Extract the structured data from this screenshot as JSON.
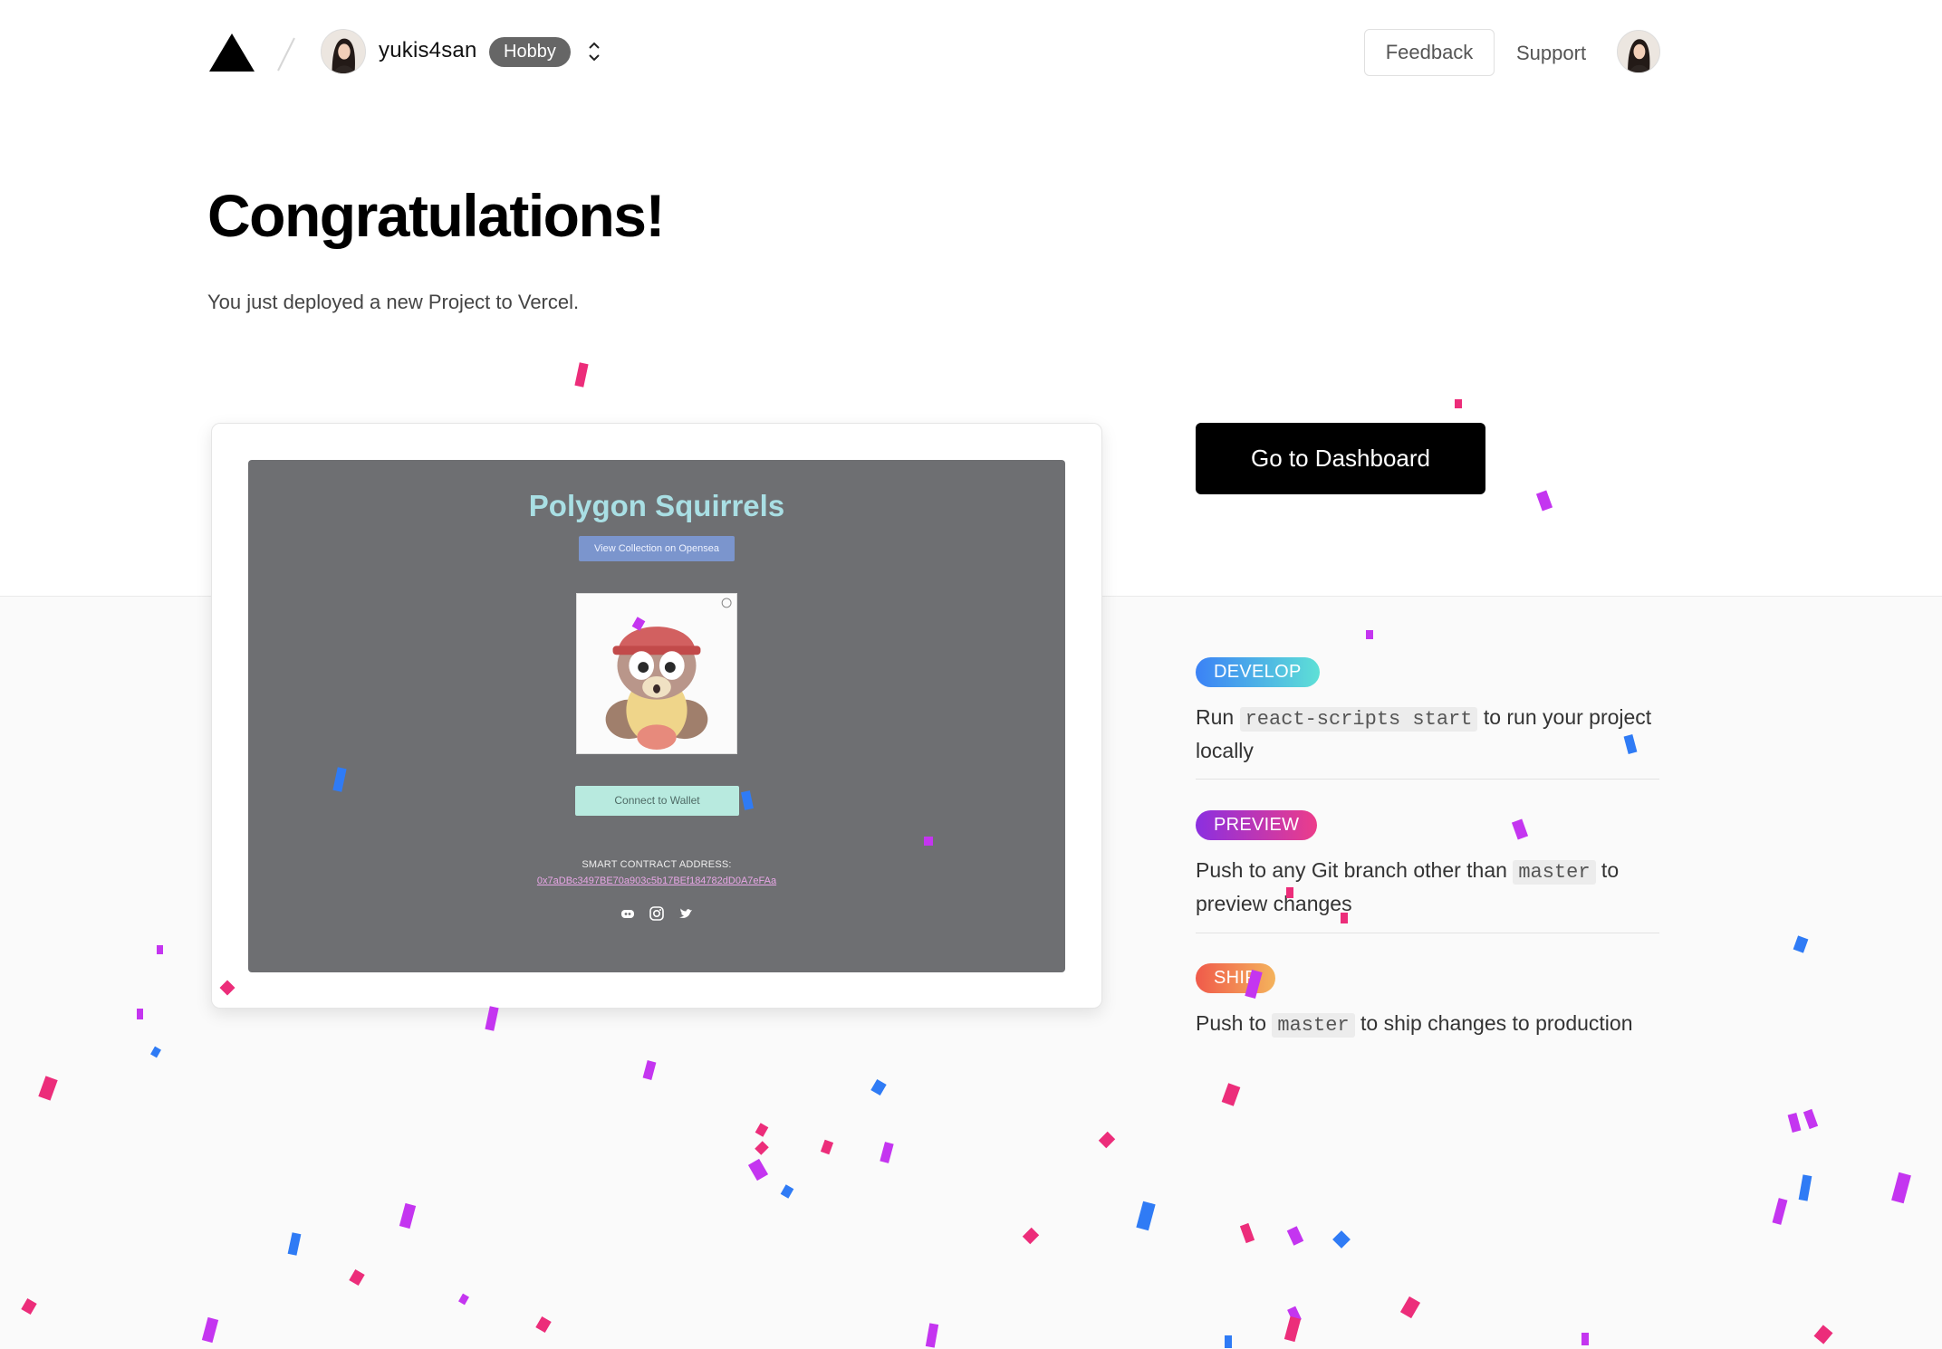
{
  "header": {
    "username": "yukis4san",
    "plan_badge": "Hobby",
    "feedback_label": "Feedback",
    "support_label": "Support"
  },
  "hero": {
    "title": "Congratulations!",
    "subtitle": "You just deployed a new Project to Vercel."
  },
  "preview": {
    "site_title": "Polygon Squirrels",
    "collection_button": "View Collection on Opensea",
    "connect_button": "Connect to Wallet",
    "contract_label": "SMART CONTRACT ADDRESS:",
    "contract_address": "0x7aDBc3497BE70a903c5b17BEf184782dD0A7eFAa",
    "social_icons": [
      "discord-icon",
      "instagram-icon",
      "twitter-icon"
    ]
  },
  "actions": {
    "dashboard_label": "Go to Dashboard"
  },
  "steps": [
    {
      "badge": "DEVELOP",
      "text_before": "Run ",
      "code": "react-scripts start",
      "text_after": " to run your project locally",
      "gradient": [
        "#3b82f6",
        "#5ee0d6"
      ]
    },
    {
      "badge": "PREVIEW",
      "text_before": "Push to any Git branch other than ",
      "code": "master",
      "text_after": " to preview changes",
      "gradient": [
        "#8b2fe0",
        "#ec3d8a"
      ]
    },
    {
      "badge": "SHIP",
      "text_before": "Push to ",
      "code": "master",
      "text_after": " to ship changes to production",
      "gradient": [
        "#f05a4a",
        "#f4b35c"
      ]
    }
  ],
  "colors": {
    "confetti": [
      "#ec2d7a",
      "#2f7bf5",
      "#c435f0"
    ],
    "badge": "#666666",
    "button": "#000000"
  }
}
